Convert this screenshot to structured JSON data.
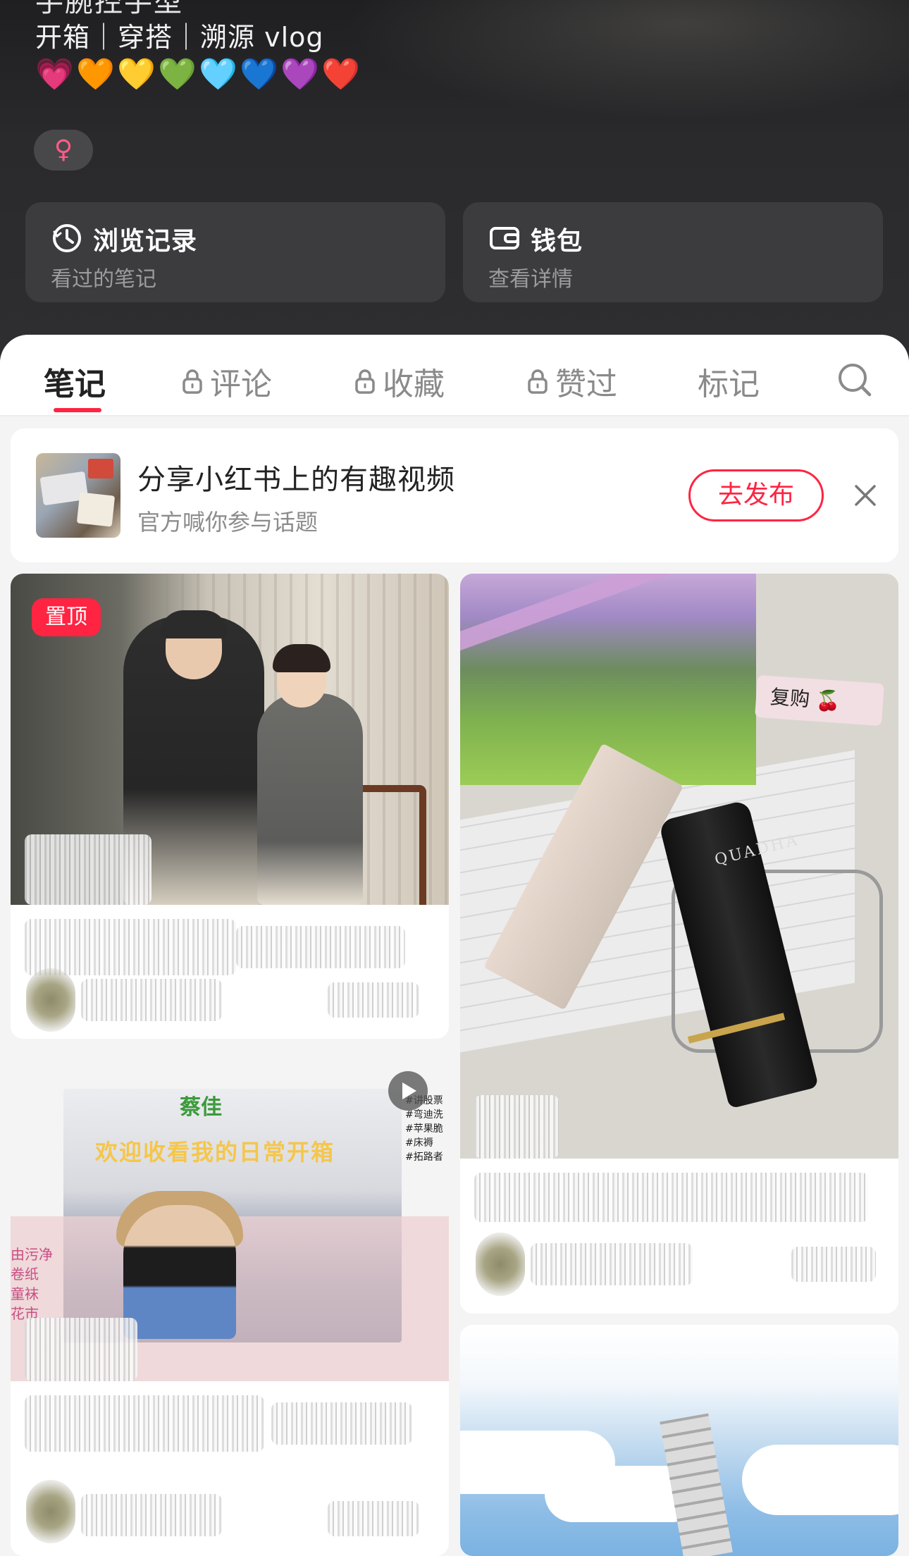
{
  "profile": {
    "bio_cut_line": "手腕控手型",
    "bio_line": "开箱｜穿搭｜溯源 vlog",
    "hearts": [
      "💗",
      "🧡",
      "💛",
      "💚",
      "🩵",
      "💙",
      "💜",
      "❤️"
    ],
    "heart_colors": [
      "#ff3fb0",
      "#ff8a1c",
      "#ffc61a",
      "#2fc43a",
      "#6fd0ff",
      "#1f6fff",
      "#a24dff",
      "#ff2b2b"
    ],
    "gender_symbol": "♀"
  },
  "quick_cards": [
    {
      "title": "浏览记录",
      "subtitle": "看过的笔记",
      "icon": "clock-icon"
    },
    {
      "title": "钱包",
      "subtitle": "查看详情",
      "icon": "wallet-icon"
    }
  ],
  "tabs": [
    {
      "label": "笔记",
      "locked": false,
      "active": true
    },
    {
      "label": "评论",
      "locked": true,
      "active": false
    },
    {
      "label": "收藏",
      "locked": true,
      "active": false
    },
    {
      "label": "赞过",
      "locked": true,
      "active": false
    },
    {
      "label": "标记",
      "locked": false,
      "active": false
    }
  ],
  "promo": {
    "title": "分享小红书上的有趣视频",
    "subtitle": "官方喊你参与话题",
    "button": "去发布"
  },
  "notes": {
    "pinned_badge": "置顶",
    "product_sticker": "复购 🍒",
    "product_brand": "QUADHA",
    "vlog_headline": "欢迎收看我的日常开箱",
    "vlog_green": "蔡佳",
    "vlog_tags": "#讲股票\n#弯迪洗\n#苹果脆\n#床褥\n#拓路者",
    "vlog_left": "由污净\n卷纸\n童袜\n花市"
  },
  "colors": {
    "accent": "#ff2442",
    "dark_bg": "#2b2b2d",
    "card_bg": "#3c3c3e"
  }
}
